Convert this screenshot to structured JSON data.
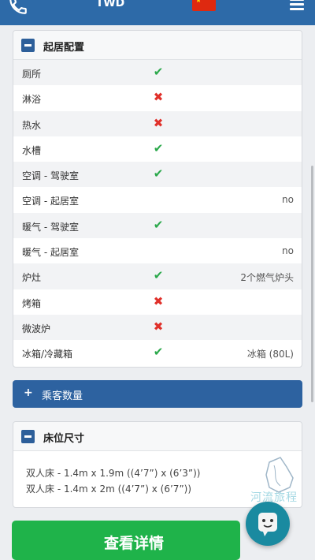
{
  "topbar": {
    "title": "TWD"
  },
  "amenities": {
    "title": "起居配置",
    "rows": [
      {
        "label": "厕所",
        "status": "yes",
        "note": ""
      },
      {
        "label": "淋浴",
        "status": "no",
        "note": ""
      },
      {
        "label": "热水",
        "status": "no",
        "note": ""
      },
      {
        "label": "水槽",
        "status": "yes",
        "note": ""
      },
      {
        "label": "空调 - 驾驶室",
        "status": "yes",
        "note": ""
      },
      {
        "label": "空调 - 起居室",
        "status": "",
        "note": "no"
      },
      {
        "label": "暖气 - 驾驶室",
        "status": "yes",
        "note": ""
      },
      {
        "label": "暖气 - 起居室",
        "status": "",
        "note": "no"
      },
      {
        "label": "炉灶",
        "status": "yes",
        "note": "2个燃气炉头"
      },
      {
        "label": "烤箱",
        "status": "no",
        "note": ""
      },
      {
        "label": "微波炉",
        "status": "no",
        "note": ""
      },
      {
        "label": "冰箱/冷藏箱",
        "status": "yes",
        "note": "冰箱 (80L)"
      }
    ]
  },
  "passengers": {
    "label": "乘客数量"
  },
  "beds": {
    "title": "床位尺寸",
    "lines": [
      "双人床 - 1.4m x 1.9m ((4’7”) x (6’3”))",
      "双人床 - 1.4m x 2m ((4’7”) x (6’7”))"
    ]
  },
  "watermark": {
    "text": "河流旅程"
  },
  "cta": {
    "label": "查看详情"
  },
  "colors": {
    "primary": "#2d62a0",
    "check": "#2aa84a",
    "cross": "#e0302a",
    "cta": "#1fb34a"
  }
}
